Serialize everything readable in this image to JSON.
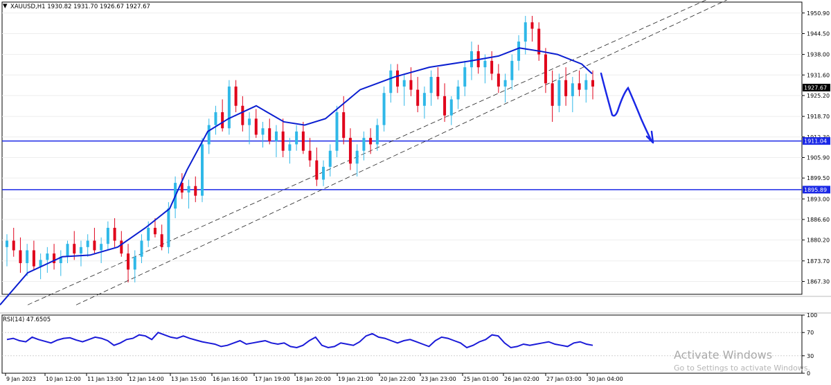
{
  "header": {
    "symbol_caret": "▼",
    "title": "XAUUSD,H1",
    "ohlc": "1930.82 1931.70 1926.67 1927.67"
  },
  "rsi": {
    "label": "RSI(14) 47.6505",
    "levels": [
      100,
      70,
      30,
      0
    ],
    "ticks": [
      "100",
      "70",
      "30",
      "0"
    ]
  },
  "watermark": {
    "title": "Activate Windows",
    "subtitle": "Go to Settings to activate Windows."
  },
  "colors": {
    "bull": "#2fb8e8",
    "bear": "#e0001a",
    "ma": "#0a1ed0",
    "hline": "#1a28e6",
    "rsi": "#1a1ad8",
    "drawing": "#1a28e6",
    "current_price_bg": "#000000"
  },
  "chart_data": [
    {
      "type": "candlestick",
      "title": "XAUUSD,H1",
      "ylim": [
        1863.3,
        1954.3
      ],
      "y_ticks": [
        "1950.90",
        "1944.50",
        "1938.00",
        "1931.60",
        "1925.20",
        "1918.70",
        "1912.30",
        "1905.90",
        "1899.50",
        "1893.00",
        "1886.60",
        "1880.20",
        "1873.70",
        "1867.30"
      ],
      "x_ticks": [
        "9 Jan 2023",
        "10 Jan 12:00",
        "11 Jan 13:00",
        "12 Jan 14:00",
        "13 Jan 15:00",
        "16 Jan 16:00",
        "17 Jan 19:00",
        "18 Jan 20:00",
        "19 Jan 21:00",
        "20 Jan 22:00",
        "23 Jan 23:00",
        "25 Jan 01:00",
        "26 Jan 02:00",
        "27 Jan 03:00",
        "30 Jan 04:00"
      ],
      "current_price": "1927.67",
      "horizontal_levels": [
        "1911.04",
        "1895.89"
      ],
      "moving_average_path": [
        [
          0,
          1860
        ],
        [
          40,
          1870
        ],
        [
          90,
          1875
        ],
        [
          130,
          1875.5
        ],
        [
          170,
          1878
        ],
        [
          210,
          1884
        ],
        [
          245,
          1890
        ],
        [
          270,
          1902
        ],
        [
          300,
          1914
        ],
        [
          330,
          1918
        ],
        [
          370,
          1922
        ],
        [
          410,
          1917
        ],
        [
          440,
          1916
        ],
        [
          470,
          1918
        ],
        [
          520,
          1927
        ],
        [
          570,
          1931
        ],
        [
          620,
          1934
        ],
        [
          680,
          1936
        ],
        [
          720,
          1937.5
        ],
        [
          750,
          1940
        ],
        [
          780,
          1939
        ],
        [
          805,
          1938
        ],
        [
          840,
          1935
        ],
        [
          855,
          1932
        ]
      ],
      "channel_lines": [
        [
          [
            40,
            1860
          ],
          [
            1020,
            1955
          ]
        ],
        [
          [
            110,
            1860
          ],
          [
            1050,
            1955
          ]
        ]
      ],
      "candles_ohlc_note": "OHLC values per bar (1 bar ≈ one H1 period)",
      "candles": [
        [
          1878,
          1882,
          1872,
          1880
        ],
        [
          1880,
          1884,
          1875,
          1877
        ],
        [
          1877,
          1881,
          1870,
          1873
        ],
        [
          1873,
          1879,
          1869,
          1877
        ],
        [
          1877,
          1880,
          1871,
          1872
        ],
        [
          1872,
          1876,
          1868,
          1874
        ],
        [
          1874,
          1878,
          1870,
          1876
        ],
        [
          1876,
          1879,
          1871,
          1873
        ],
        [
          1873,
          1877,
          1869,
          1875
        ],
        [
          1875,
          1880,
          1873,
          1879
        ],
        [
          1879,
          1883,
          1874,
          1876
        ],
        [
          1876,
          1880,
          1872,
          1878
        ],
        [
          1878,
          1882,
          1875,
          1880
        ],
        [
          1880,
          1884,
          1876,
          1877
        ],
        [
          1877,
          1881,
          1873,
          1879
        ],
        [
          1879,
          1886,
          1877,
          1884
        ],
        [
          1884,
          1887,
          1878,
          1880
        ],
        [
          1880,
          1883,
          1875,
          1876
        ],
        [
          1876,
          1879,
          1867,
          1871
        ],
        [
          1871,
          1877,
          1867,
          1875
        ],
        [
          1875,
          1882,
          1873,
          1880
        ],
        [
          1880,
          1886,
          1878,
          1884
        ],
        [
          1884,
          1887,
          1881,
          1882
        ],
        [
          1882,
          1885,
          1877,
          1878
        ],
        [
          1878,
          1892,
          1876,
          1890
        ],
        [
          1890,
          1900,
          1887,
          1898
        ],
        [
          1898,
          1901,
          1893,
          1895
        ],
        [
          1895,
          1899,
          1890,
          1897
        ],
        [
          1897,
          1900,
          1892,
          1894
        ],
        [
          1894,
          1912,
          1892,
          1910
        ],
        [
          1910,
          1918,
          1907,
          1916
        ],
        [
          1916,
          1922,
          1913,
          1920
        ],
        [
          1920,
          1924,
          1914,
          1915
        ],
        [
          1915,
          1930,
          1913,
          1928
        ],
        [
          1928,
          1930,
          1920,
          1922
        ],
        [
          1922,
          1925,
          1914,
          1916
        ],
        [
          1916,
          1920,
          1910,
          1918
        ],
        [
          1918,
          1921,
          1912,
          1913
        ],
        [
          1913,
          1917,
          1909,
          1915
        ],
        [
          1915,
          1918,
          1910,
          1911
        ],
        [
          1911,
          1916,
          1906,
          1914
        ],
        [
          1914,
          1918,
          1906,
          1908
        ],
        [
          1908,
          1912,
          1904,
          1910
        ],
        [
          1910,
          1916,
          1908,
          1914
        ],
        [
          1914,
          1917,
          1907,
          1908
        ],
        [
          1908,
          1912,
          1903,
          1905
        ],
        [
          1905,
          1909,
          1897,
          1899
        ],
        [
          1899,
          1905,
          1897,
          1903
        ],
        [
          1903,
          1910,
          1900,
          1908
        ],
        [
          1908,
          1922,
          1906,
          1920
        ],
        [
          1920,
          1925,
          1910,
          1912
        ],
        [
          1912,
          1915,
          1902,
          1904
        ],
        [
          1904,
          1910,
          1900,
          1908
        ],
        [
          1908,
          1914,
          1905,
          1912
        ],
        [
          1912,
          1915,
          1907,
          1910
        ],
        [
          1910,
          1918,
          1908,
          1916
        ],
        [
          1916,
          1928,
          1914,
          1926
        ],
        [
          1926,
          1935,
          1923,
          1933
        ],
        [
          1933,
          1935,
          1926,
          1928
        ],
        [
          1928,
          1932,
          1922,
          1930
        ],
        [
          1930,
          1934,
          1925,
          1927
        ],
        [
          1927,
          1931,
          1920,
          1922
        ],
        [
          1922,
          1928,
          1918,
          1926
        ],
        [
          1926,
          1933,
          1922,
          1931
        ],
        [
          1931,
          1934,
          1924,
          1925
        ],
        [
          1925,
          1929,
          1917,
          1919
        ],
        [
          1919,
          1925,
          1916,
          1924
        ],
        [
          1924,
          1930,
          1921,
          1928
        ],
        [
          1928,
          1936,
          1925,
          1934
        ],
        [
          1934,
          1942,
          1930,
          1939
        ],
        [
          1939,
          1941,
          1932,
          1934
        ],
        [
          1934,
          1938,
          1929,
          1936
        ],
        [
          1936,
          1939,
          1930,
          1932
        ],
        [
          1932,
          1935,
          1926,
          1928
        ],
        [
          1928,
          1932,
          1923,
          1930
        ],
        [
          1930,
          1938,
          1927,
          1936
        ],
        [
          1936,
          1944,
          1933,
          1942
        ],
        [
          1942,
          1950,
          1938,
          1948
        ],
        [
          1948,
          1950,
          1942,
          1946
        ],
        [
          1946,
          1948,
          1936,
          1938
        ],
        [
          1938,
          1940,
          1926,
          1929
        ],
        [
          1929,
          1933,
          1917,
          1922
        ],
        [
          1922,
          1932,
          1920,
          1930
        ],
        [
          1930,
          1934,
          1922,
          1925
        ],
        [
          1925,
          1931,
          1920,
          1929
        ],
        [
          1929,
          1933,
          1925,
          1927
        ],
        [
          1927,
          1932,
          1923,
          1930
        ],
        [
          1930,
          1933,
          1924,
          1928
        ]
      ]
    },
    {
      "type": "line",
      "title": "RSI(14) 47.6505",
      "ylim": [
        0,
        100
      ],
      "values": [
        58,
        60,
        56,
        54,
        62,
        58,
        55,
        52,
        57,
        60,
        61,
        57,
        54,
        58,
        62,
        60,
        56,
        48,
        52,
        58,
        60,
        66,
        64,
        58,
        70,
        66,
        62,
        60,
        64,
        60,
        57,
        54,
        52,
        50,
        46,
        48,
        52,
        56,
        50,
        52,
        54,
        56,
        52,
        50,
        52,
        46,
        44,
        48,
        56,
        62,
        48,
        44,
        46,
        52,
        50,
        48,
        54,
        64,
        68,
        62,
        60,
        56,
        52,
        56,
        58,
        54,
        50,
        46,
        56,
        62,
        60,
        56,
        52,
        44,
        48,
        54,
        58,
        66,
        64,
        52,
        44,
        46,
        50,
        48,
        50,
        52,
        54,
        50,
        48,
        46,
        52,
        54,
        50,
        48
      ]
    }
  ]
}
